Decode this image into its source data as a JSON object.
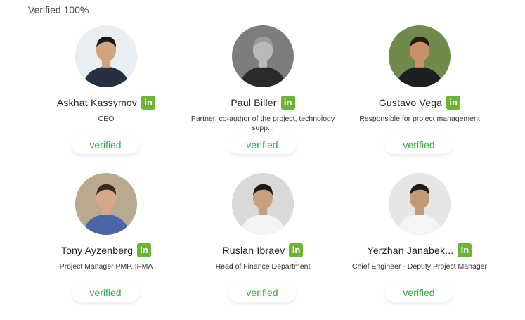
{
  "header": {
    "title": "Verified 100%"
  },
  "team": [
    {
      "name": "Askhat Kassymov",
      "role": "CEO",
      "badge": "verified",
      "linkedin": "in",
      "photo": {
        "bg": "#e9eef2",
        "suit": "#253142",
        "skin": "#d2a37f",
        "hair": "#1b1b1b"
      }
    },
    {
      "name": "Paul Biller",
      "role": "Partner, co-author of the project, technology supp...",
      "badge": "verified",
      "linkedin": "in",
      "photo": {
        "bg": "#7d7d7d",
        "suit": "#2a2a2a",
        "skin": "#b9b9b9",
        "hair": "#9a9a9a"
      }
    },
    {
      "name": "Gustavo Vega",
      "role": "Responsible for project management",
      "badge": "verified",
      "linkedin": "in",
      "photo": {
        "bg": "#6f8a4a",
        "suit": "#1d1f24",
        "skin": "#c8916a",
        "hair": "#2a1c12"
      }
    },
    {
      "name": "Tony Ayzenberg",
      "role": "Project Manager PMP, IPMA",
      "badge": "verified",
      "linkedin": "in",
      "photo": {
        "bg": "#b8a98f",
        "suit": "#4a66a8",
        "skin": "#d7a888",
        "hair": "#3b2a1c"
      }
    },
    {
      "name": "Ruslan Ibraev",
      "role": "Head of Finance Department",
      "badge": "verified",
      "linkedin": "in",
      "photo": {
        "bg": "#d9d9d9",
        "suit": "#f3f3f3",
        "skin": "#c9a07e",
        "hair": "#1a1a1a"
      }
    },
    {
      "name": "Yerzhan Janabek...",
      "role": "Chief Engineer - Deputy Project Manager",
      "badge": "verified",
      "linkedin": "in",
      "photo": {
        "bg": "#e6e6e6",
        "suit": "#f5f5f5",
        "skin": "#c39a78",
        "hair": "#1c1c1c"
      }
    }
  ],
  "colors": {
    "accent_green": "#3aa645",
    "linkedin_bg": "#6cb433"
  }
}
